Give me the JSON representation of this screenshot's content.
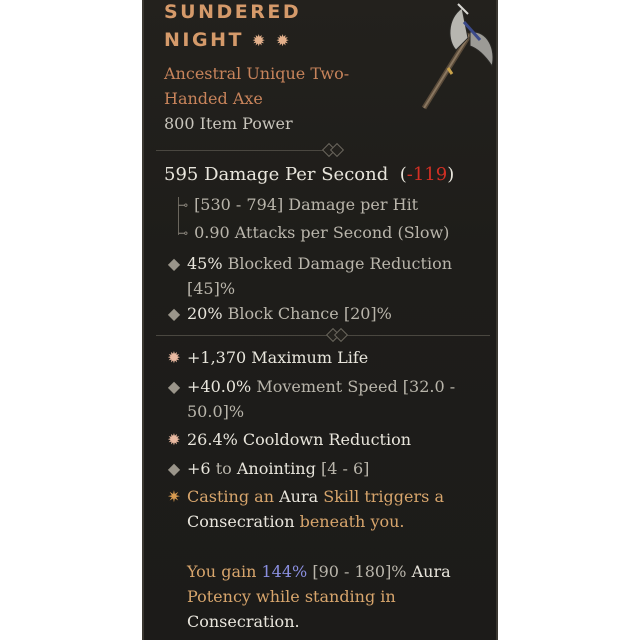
{
  "item": {
    "name_line1": "SUNDERED",
    "name_line2": "NIGHT",
    "name_marks": "✹ ✹",
    "type_line1": "Ancestral Unique Two-",
    "type_line2": "Handed Axe",
    "item_power": "800 Item Power"
  },
  "damage": {
    "dps_text": "595 Damage Per Second",
    "dps_diff": "-119",
    "per_hit": "[530 - 794] Damage per Hit",
    "attack_speed": "0.90 Attacks per Second (Slow)"
  },
  "implicits": [
    {
      "icon": "diamond-icon",
      "value": "45%",
      "label": "Blocked Damage Reduction",
      "range_line1": "",
      "range_line2": "[45]%"
    },
    {
      "icon": "diamond-icon",
      "value": "20%",
      "label": "Block Chance",
      "range": "[20]%"
    }
  ],
  "affixes": [
    {
      "icon": "greater-affix-icon",
      "text": "+1,370 Maximum Life"
    },
    {
      "icon": "diamond-icon",
      "value": "+40.0%",
      "label": "Movement Speed",
      "range_a": "[32.0 -",
      "range_b": "50.0]%"
    },
    {
      "icon": "greater-affix-icon",
      "text": "26.4% Cooldown Reduction"
    },
    {
      "icon": "diamond-icon",
      "value": "+6",
      "to": "to",
      "label": "Anointing",
      "range": "[4 - 6]"
    }
  ],
  "unique_power": {
    "icon": "unique-star-icon",
    "p1": "Casting an",
    "p2": "Aura",
    "p3": "Skill triggers a",
    "p4": "Consecration",
    "p5": "beneath you.",
    "q1": "You gain",
    "q2": "144%",
    "q3": "[90 - 180]%",
    "q4": "Aura",
    "q5": "Potency while standing in",
    "q6": "Consecration."
  },
  "colors": {
    "unique_title": "#d59a6a",
    "negative": "#d22f24",
    "highlight_value": "#8a8fe0",
    "unique_text": "#d7a56c"
  }
}
